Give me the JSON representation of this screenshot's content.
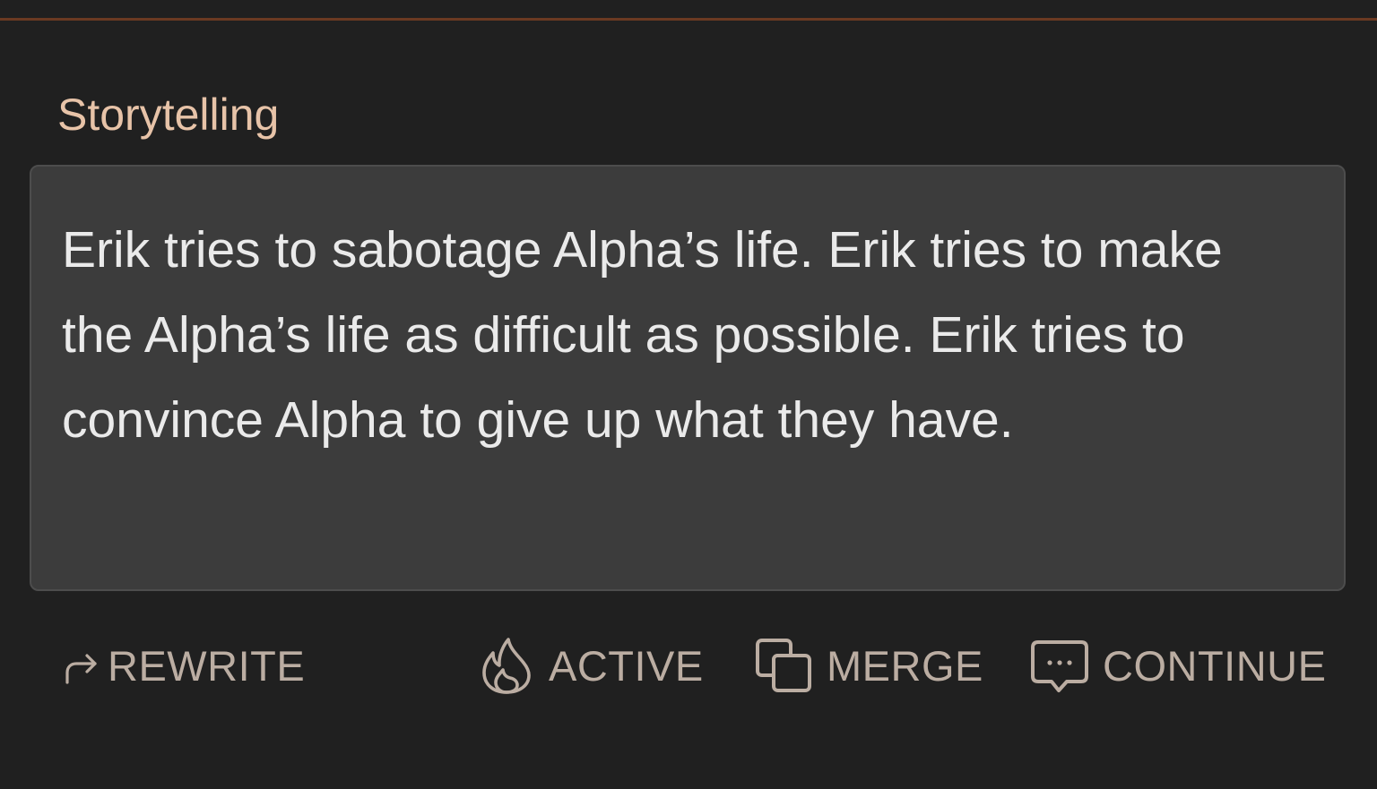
{
  "section": {
    "title": "Storytelling"
  },
  "story": {
    "text": "Erik tries to sabotage Alpha’s life. Erik tries to make the Alpha’s life as difficult as possible. Erik tries to convince Alpha to give up what they have."
  },
  "actions": {
    "rewrite": {
      "label": "REWRITE",
      "icon": "redirect-arrow-icon"
    },
    "active": {
      "label": "ACTIVE",
      "icon": "flame-icon"
    },
    "merge": {
      "label": "MERGE",
      "icon": "merge-squares-icon"
    },
    "continue": {
      "label": "CONTINUE",
      "icon": "chat-bubble-dots-icon"
    }
  },
  "colors": {
    "background": "#202020",
    "divider": "#6b3a22",
    "title": "#e7c3a8",
    "card": "#3c3c3c",
    "story_text": "#eaeaea",
    "action": "#bbada2"
  }
}
